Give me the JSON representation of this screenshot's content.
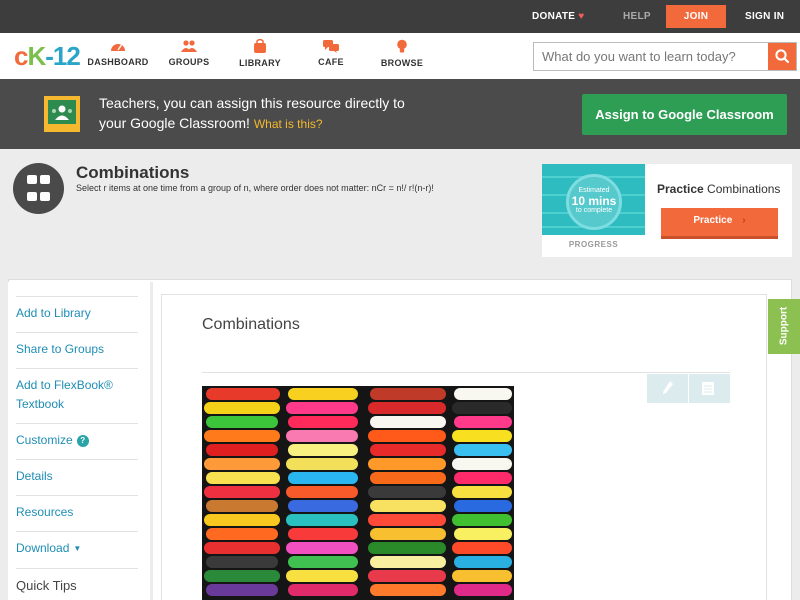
{
  "topbar": {
    "donate": "DONATE",
    "help": "HELP",
    "join": "JOIN",
    "signin": "SIGN IN"
  },
  "logo": {
    "text": "CK-12"
  },
  "nav": {
    "items": [
      {
        "label": "DASHBOARD",
        "icon": "gauge-icon"
      },
      {
        "label": "GROUPS",
        "icon": "people-icon"
      },
      {
        "label": "LIBRARY",
        "icon": "bag-icon"
      },
      {
        "label": "CAFE",
        "icon": "chat-icon"
      },
      {
        "label": "BROWSE",
        "icon": "lightbulb-icon"
      }
    ],
    "search_placeholder": "What do you want to learn today?"
  },
  "banner": {
    "line1": "Teachers, you can assign this resource directly to",
    "line2": "your Google Classroom!",
    "what_link": "What is this?",
    "assign_button": "Assign to Google Classroom"
  },
  "concept": {
    "title": "Combinations",
    "subtitle": "Select r items at one time from a group of n, where order does not matter: nCr = n!/ r!(n-r)!"
  },
  "practice_card": {
    "estimated": "Estimated",
    "minutes": "10 mins",
    "to_complete": "to complete",
    "progress_label": "PROGRESS",
    "label_bold": "Practice",
    "label_rest": "Combinations",
    "button": "Practice"
  },
  "sidebar": {
    "items": [
      "Add to Library",
      "Share to Groups",
      "Add to FlexBook® Textbook",
      "Customize",
      "Details",
      "Resources",
      "Download",
      "Quick Tips"
    ]
  },
  "content": {
    "title": "Combinations"
  },
  "support": {
    "label": "Support"
  },
  "colors": {
    "accent_orange": "#f26a3b",
    "classroom_green": "#2e9e55",
    "link_blue": "#1f8db5",
    "support_green": "#8cc152"
  }
}
